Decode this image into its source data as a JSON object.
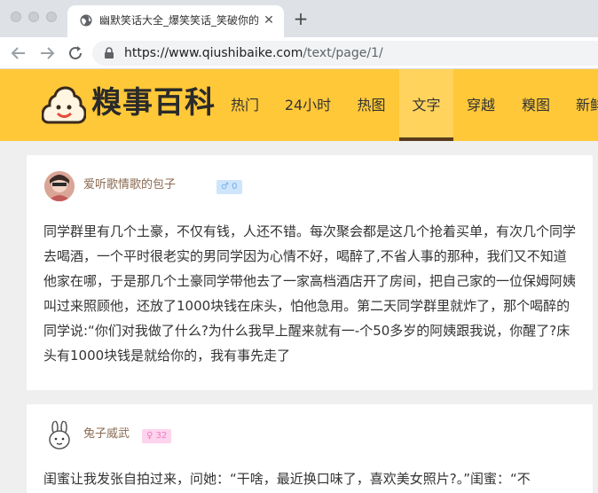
{
  "browser": {
    "tab_title": "幽默笑话大全_爆笑笑话_笑破你的肚子",
    "tab_close": "✕",
    "new_tab": "+",
    "url_host": "https://www.qiushibaike.com",
    "url_path": "/text/page/1/"
  },
  "site": {
    "logo_text": "糗事百科",
    "nav": [
      {
        "label": "热门"
      },
      {
        "label": "24小时"
      },
      {
        "label": "热图"
      },
      {
        "label": "文字",
        "active": true
      },
      {
        "label": "穿越"
      },
      {
        "label": "糗图"
      },
      {
        "label": "新鲜"
      }
    ],
    "accent_color": "#ffc839"
  },
  "posts": [
    {
      "username": "爱听歌情歌的包子",
      "gender_badge": "♂ 0",
      "text": "同学群里有几个土豪，不仅有钱，人还不错。每次聚会都是这几个抢着买单，有次几个同学去喝酒，一个平时很老实的男同学因为心情不好，喝醉了,不省人事的那种，我们又不知道他家在哪，于是那几个土豪同学带他去了一家高档酒店开了房间，把自己家的一位保姆阿姨叫过来照顾他，还放了1000块钱在床头，怕他急用。第二天同学群里就炸了，那个喝醉的同学说:“你们对我做了什么?为什么我早上醒来就有一-个50多岁的阿姨跟我说，你醒了?床头有1000块钱是就给你的，我有事先走了"
    },
    {
      "username": "兔子威武",
      "gender_badge": "♀ 32",
      "text": "闺蜜让我发张自拍过来，问她：“干啥，最近换口味了，喜欢美女照片?。”闺蜜：“不"
    }
  ]
}
